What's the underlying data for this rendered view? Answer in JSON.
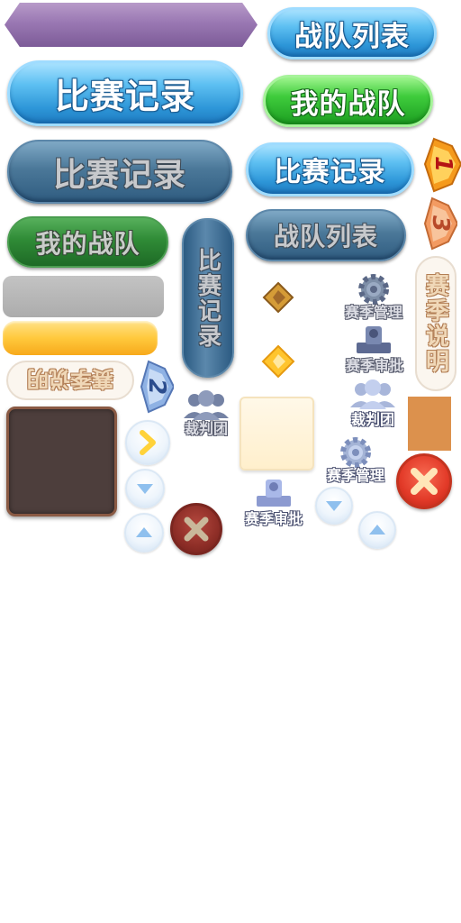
{
  "buttons": {
    "team_list_blue": "战队列表",
    "match_record_blue_large": "比赛记录",
    "my_team_green": "我的战队",
    "match_record_dark_large": "比赛记录",
    "match_record_blue_medium": "比赛记录",
    "my_team_dark_green": "我的战队",
    "team_list_dark": "战队列表",
    "match_record_vertical": "比赛记录",
    "season_desc_vertical": "赛季说明",
    "season_desc_mirrored": "赛季说明"
  },
  "ranks": [
    "1",
    "3",
    "2"
  ],
  "icons": {
    "season_manage_a": "赛季管理",
    "season_approve_a": "赛季审批",
    "referee_a": "裁判团",
    "referee_b": "裁判团",
    "season_manage_b": "赛季管理",
    "season_approve_b": "赛季审批"
  },
  "colors": {
    "accent_blue": "#2d96d8",
    "accent_green": "#1c9e21",
    "close_red": "#e23a28",
    "swatch_dark": "#4d3e3c",
    "swatch_orange": "#dc914d",
    "swatch_cream": "#fff3d6"
  }
}
